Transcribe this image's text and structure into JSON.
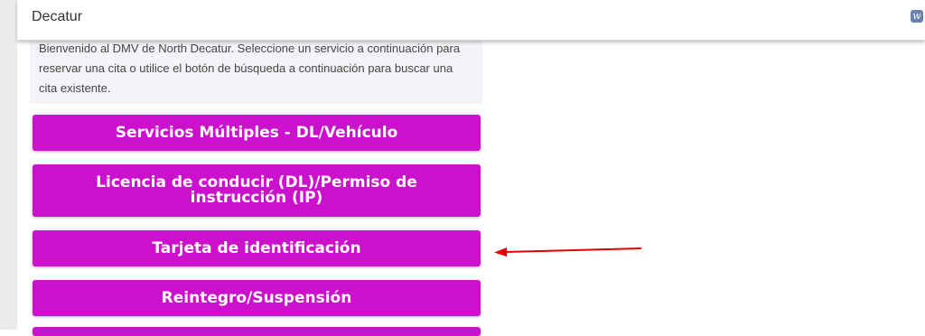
{
  "header": {
    "title": "Decatur",
    "logo_glyph": "w"
  },
  "intro": {
    "text": "Bienvenido al DMV de North Decatur. Seleccione un servicio a continuación para reservar una cita o utilice el botón de búsqueda a continuación para buscar una cita existente."
  },
  "services": [
    {
      "label": "Servicios Múltiples - DL/Vehículo"
    },
    {
      "label": "Licencia de conducir (DL)/Permiso de instrucción (IP)"
    },
    {
      "label": "Tarjeta de identificación"
    },
    {
      "label": "Reintegro/Suspensión"
    },
    {
      "label": ""
    }
  ],
  "colors": {
    "button": "#cc11cc",
    "annotation_arrow": "#e00000"
  }
}
